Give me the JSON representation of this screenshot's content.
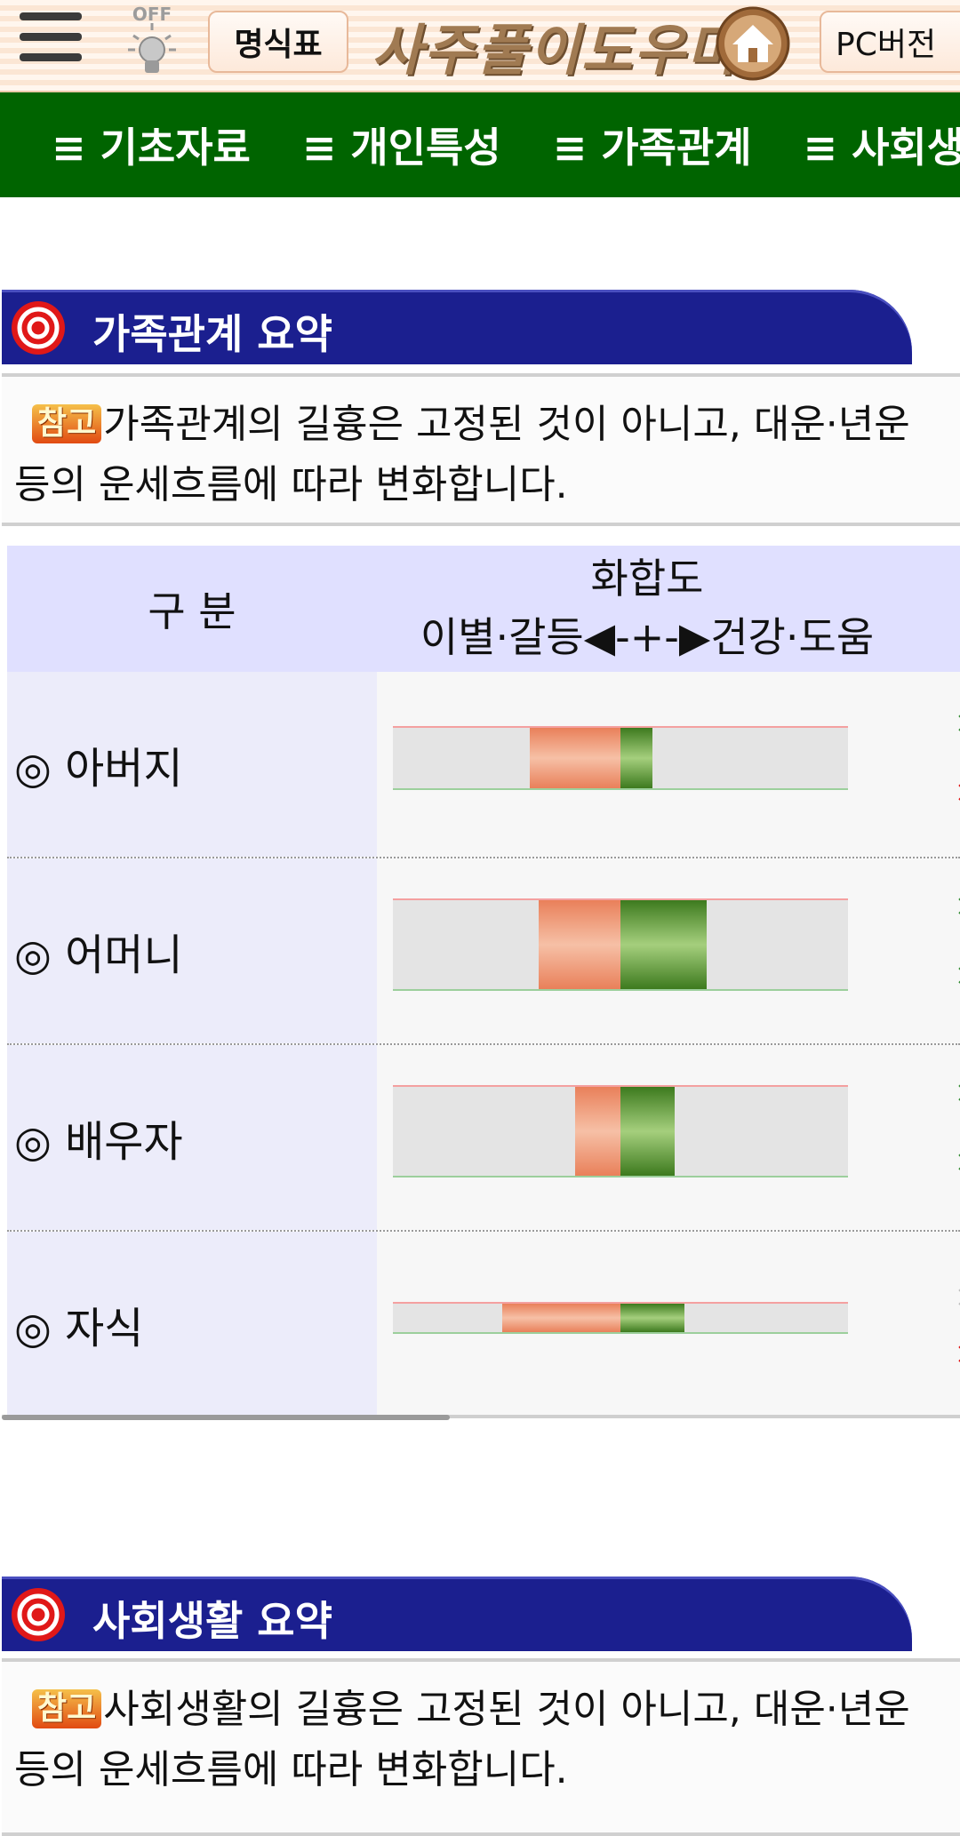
{
  "topbar": {
    "menu_icon": "hamburger-icon",
    "bulb_label": "OFF",
    "myeongsik_button": "명식표",
    "logo_text": "사주풀이도우미",
    "home_icon": "home-icon",
    "pc_button": "PC버전"
  },
  "nav": {
    "items": [
      "≡ 기초자료",
      "≡ 개인특성",
      "≡ 가족관계",
      "≡ 사회생활"
    ]
  },
  "family_section": {
    "title": "가족관계 요약",
    "badge": "참고",
    "note": "가족관계의 길흉은 고정된 것이 아니고, 대운·년운 등의 운세흐름에 따라 변화합니다.",
    "header_gubun": "구 분",
    "header_harmony": "화합도",
    "header_scale": "이별·갈등◀-+-▶건강·도움",
    "rows": [
      {
        "label": "◎ 아버지",
        "neg": 0.2,
        "pos": 0.07,
        "marks": [
          "green",
          "red"
        ]
      },
      {
        "label": "◎ 어머니",
        "neg": 0.18,
        "pos": 0.19,
        "marks": [
          "green",
          "green"
        ]
      },
      {
        "label": "◎ 배우자",
        "neg": 0.1,
        "pos": 0.12,
        "marks": [
          "green",
          "green"
        ]
      },
      {
        "label": "◎ 자식",
        "neg": 0.26,
        "pos": 0.14,
        "marks": [
          "gray",
          "red"
        ]
      }
    ]
  },
  "social_section": {
    "title": "사회생활 요약",
    "badge": "참고",
    "note": "사회생활의 길흉은 고정된 것이 아니고, 대운·년운 등의 운세흐름에 따라 변화합니다."
  },
  "colors": {
    "nav_green": "#006400",
    "section_blue": "#1b1f8f",
    "mark_green": "#2f8a2f",
    "mark_red": "#e01010",
    "mark_gray": "#bdbdbd"
  }
}
